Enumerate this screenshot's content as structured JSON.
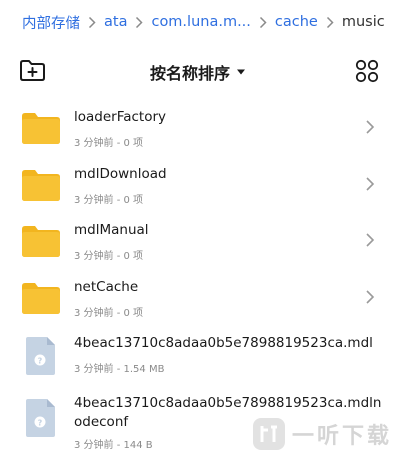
{
  "breadcrumb": {
    "items": [
      "内部存储",
      "ata",
      "com.luna.m...",
      "cache",
      "music"
    ]
  },
  "toolbar": {
    "sort_label": "按名称排序",
    "icons": {
      "left": "new-folder-icon",
      "right": "grid-view-icon",
      "caret": "caret-down-icon"
    }
  },
  "folders": [
    {
      "name": "loaderFactory",
      "meta": "3 分钟前 - 0 项"
    },
    {
      "name": "mdlDownload",
      "meta": "3 分钟前 - 0 项"
    },
    {
      "name": "mdlManual",
      "meta": "3 分钟前 - 0 项"
    },
    {
      "name": "netCache",
      "meta": "3 分钟前 - 0 项"
    }
  ],
  "files": [
    {
      "name": "4beac13710c8adaa0b5e7898819523ca.mdl",
      "meta": "3 分钟前 - 1.54 MB"
    },
    {
      "name_line1": "4beac13710c8adaa0b5e7898819523ca.mdln",
      "name_line2": "odeconf",
      "meta": "3 分钟前 - 144 B"
    }
  ],
  "colors": {
    "accent": "#2f6fe0",
    "folder": "#f7c234",
    "folder_tab": "#f2b51f",
    "file": "#c5d3e3",
    "text_secondary": "#8a8a8a"
  },
  "watermark": {
    "text": "一听下载"
  }
}
